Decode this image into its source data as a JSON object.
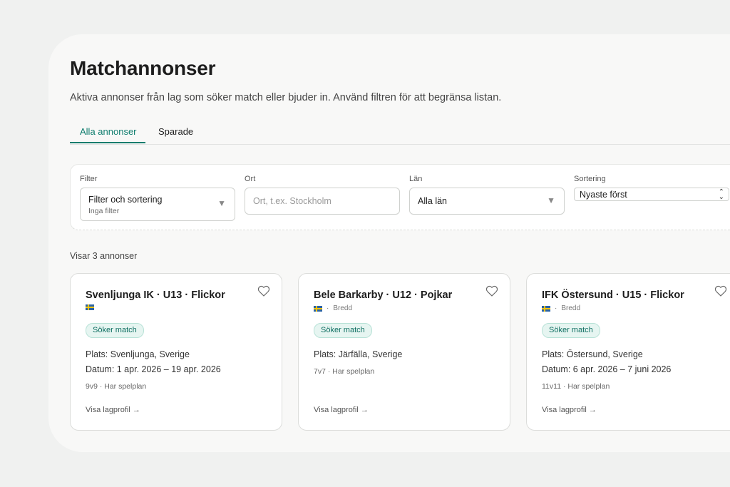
{
  "page": {
    "title": "Matchannonser",
    "subtitle": "Aktiva annonser från lag som söker match eller bjuder in. Använd filtren för att begränsa listan."
  },
  "tabs": [
    {
      "label": "Alla annonser",
      "active": true
    },
    {
      "label": "Sparade",
      "active": false
    }
  ],
  "filters": {
    "filter": {
      "label": "Filter",
      "value": "Filter och sortering",
      "sub": "Inga filter"
    },
    "ort": {
      "label": "Ort",
      "placeholder": "Ort, t.ex. Stockholm"
    },
    "lan": {
      "label": "Län",
      "value": "Alla län"
    },
    "sort": {
      "label": "Sortering",
      "value": "Nyaste först"
    }
  },
  "results": {
    "count_text": "Visar 3 annonser"
  },
  "cards": [
    {
      "title": "Svenljunga IK · U13 · Flickor",
      "meta": "",
      "badge": "Söker match",
      "place": "Plats: Svenljunga, Sverige",
      "date": "Datum: 1 apr. 2026 – 19 apr. 2026",
      "detail": "9v9 · Har spelplan",
      "link": "Visa lagprofil →"
    },
    {
      "title": "Bele Barkarby · U12 · Pojkar",
      "meta": "Bredd",
      "badge": "Söker match",
      "place": "Plats: Järfälla, Sverige",
      "date": "",
      "detail": "7v7 · Har spelplan",
      "link": "Visa lagprofil →"
    },
    {
      "title": "IFK Östersund · U15 · Flickor",
      "meta": "Bredd",
      "badge": "Söker match",
      "place": "Plats: Östersund, Sverige",
      "date": "Datum: 6 apr. 2026 – 7 juni 2026",
      "detail": "11v11 · Har spelplan",
      "link": "Visa lagprofil →"
    }
  ],
  "icons": {
    "favorite": "heart-icon",
    "flag": "sweden-flag-icon",
    "dropdown": "caret-down-icon"
  },
  "colors": {
    "accent": "#0f7d6e",
    "badge_bg": "#e6f5f1",
    "background": "#f0f1f0"
  }
}
